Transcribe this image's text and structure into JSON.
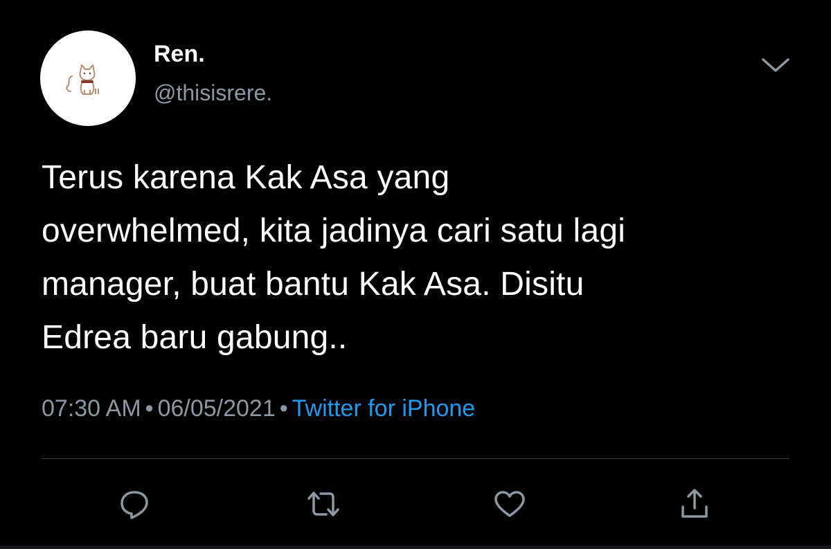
{
  "user": {
    "display_name": "Ren.",
    "handle": "@thisisrere."
  },
  "tweet": {
    "text_lines": [
      "Terus karena Kak Asa yang",
      "overwhelmed, kita jadinya cari satu lagi",
      "manager, buat bantu Kak Asa. Disitu",
      "Edrea baru gabung.."
    ],
    "time": "07:30 AM",
    "separator": "•",
    "date": "06/05/2021",
    "source": "Twitter for iPhone"
  },
  "actions": {
    "reply_icon": "reply-icon",
    "retweet_icon": "retweet-icon",
    "like_icon": "heart-icon",
    "share_icon": "share-icon"
  },
  "colors": {
    "background": "#000000",
    "text": "#ffffff",
    "secondary": "#8b98a5",
    "link": "#1d9bf0",
    "divider": "#38444d"
  }
}
